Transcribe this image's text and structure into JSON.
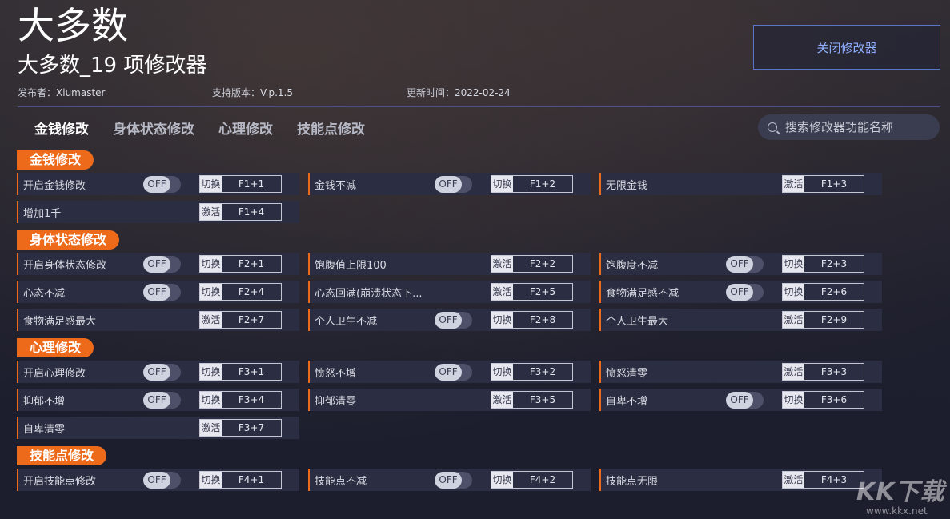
{
  "header": {
    "app_name": "大多数",
    "trainer_title": "大多数_19 项修改器",
    "publisher_label": "发布者：",
    "publisher": "Xiumaster",
    "version_label": "支持版本：",
    "version": "V.p.1.5",
    "updated_label": "更新时间：",
    "updated": "2022-02-24",
    "close_label": "关闭修改器"
  },
  "tabs": [
    {
      "label": "金钱修改",
      "active": true
    },
    {
      "label": "身体状态修改",
      "active": false
    },
    {
      "label": "心理修改",
      "active": false
    },
    {
      "label": "技能点修改",
      "active": false
    }
  ],
  "search": {
    "placeholder": "搜索修改器功能名称"
  },
  "colors": {
    "accent": "#ee6a1b",
    "background": "#1e2032",
    "row": "#2b2d42",
    "close_border": "#5b74c8"
  },
  "sections": [
    {
      "title": "金钱修改",
      "items": [
        {
          "label": "开启金钱修改",
          "toggle": "OFF",
          "action": "切换",
          "key": "F1+1"
        },
        {
          "label": "金钱不减",
          "toggle": "OFF",
          "action": "切换",
          "key": "F1+2"
        },
        {
          "label": "无限金钱",
          "action": "激活",
          "key": "F1+3"
        },
        {
          "label": "增加1千",
          "action": "激活",
          "key": "F1+4"
        }
      ]
    },
    {
      "title": "身体状态修改",
      "items": [
        {
          "label": "开启身体状态修改",
          "toggle": "OFF",
          "action": "切换",
          "key": "F2+1"
        },
        {
          "label": "饱腹值上限100",
          "action": "激活",
          "key": "F2+2"
        },
        {
          "label": "饱腹度不减",
          "toggle": "OFF",
          "action": "切换",
          "key": "F2+3"
        },
        {
          "label": "心态不减",
          "toggle": "OFF",
          "action": "切换",
          "key": "F2+4"
        },
        {
          "label": "心态回满(崩溃状态下...",
          "action": "激活",
          "key": "F2+5"
        },
        {
          "label": "食物满足感不减",
          "toggle": "OFF",
          "action": "切换",
          "key": "F2+6"
        },
        {
          "label": "食物满足感最大",
          "action": "激活",
          "key": "F2+7"
        },
        {
          "label": "个人卫生不减",
          "toggle": "OFF",
          "action": "切换",
          "key": "F2+8"
        },
        {
          "label": "个人卫生最大",
          "action": "激活",
          "key": "F2+9"
        }
      ]
    },
    {
      "title": "心理修改",
      "items": [
        {
          "label": "开启心理修改",
          "toggle": "OFF",
          "action": "切换",
          "key": "F3+1"
        },
        {
          "label": "愤怒不增",
          "toggle": "OFF",
          "action": "切换",
          "key": "F3+2"
        },
        {
          "label": "愤怒清零",
          "action": "激活",
          "key": "F3+3"
        },
        {
          "label": "抑郁不增",
          "toggle": "OFF",
          "action": "切换",
          "key": "F3+4"
        },
        {
          "label": "抑郁清零",
          "action": "激活",
          "key": "F3+5"
        },
        {
          "label": "自卑不增",
          "toggle": "OFF",
          "action": "切换",
          "key": "F3+6"
        },
        {
          "label": "自卑清零",
          "action": "激活",
          "key": "F3+7"
        }
      ]
    },
    {
      "title": "技能点修改",
      "items": [
        {
          "label": "开启技能点修改",
          "toggle": "OFF",
          "action": "切换",
          "key": "F4+1"
        },
        {
          "label": "技能点不减",
          "toggle": "OFF",
          "action": "切换",
          "key": "F4+2"
        },
        {
          "label": "技能点无限",
          "action": "激活",
          "key": "F4+3"
        }
      ]
    }
  ],
  "watermark": {
    "main": "KK下载",
    "url": "www.kkx.net"
  }
}
